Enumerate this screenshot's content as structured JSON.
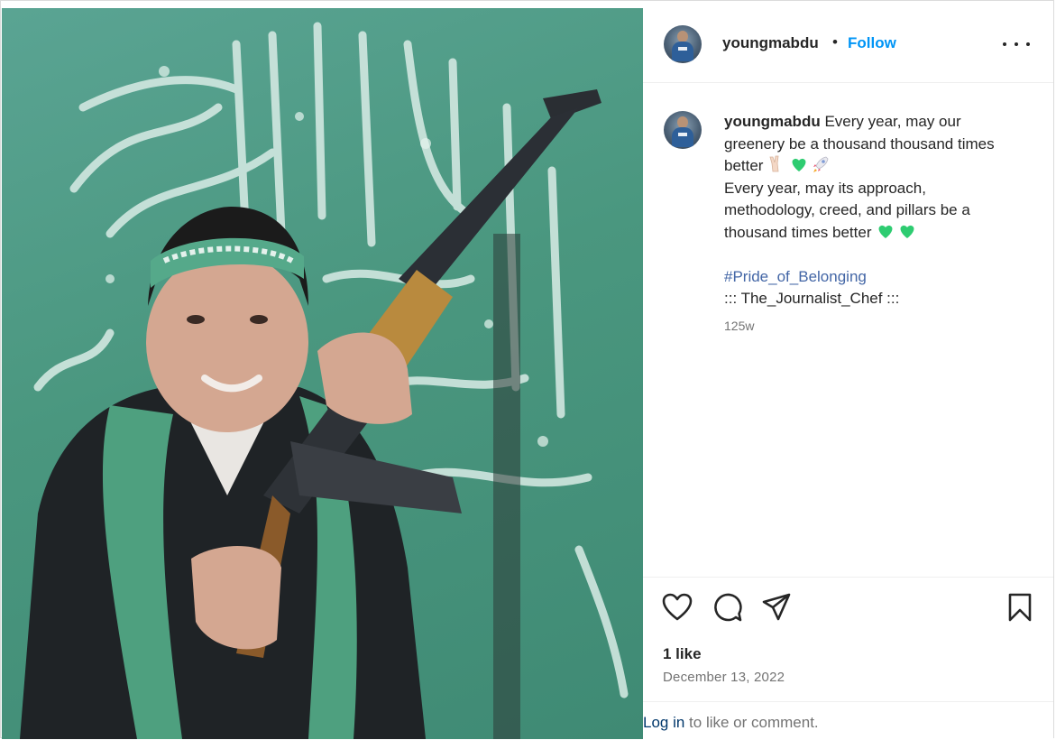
{
  "post": {
    "username": "youngmabdu",
    "follow_label": "Follow",
    "separator": "•",
    "more_icon": "more-horizontal-icon"
  },
  "caption": {
    "username": "youngmabdu",
    "line1": "Every year, may our",
    "line2": "greenery be a thousand thousand times",
    "line3": "better",
    "line3_emojis": [
      "victory-hand",
      "green-heart",
      "rocket"
    ],
    "line4": "Every year, may its approach,",
    "line5": "methodology, creed, and pillars be a",
    "line6": "thousand times better",
    "line6_emojis": [
      "green-heart",
      "green-heart"
    ],
    "hashtag": "#Pride_of_Belonging",
    "signature": "::: The_Journalist_Chef :::",
    "time_ago": "125w"
  },
  "actions": {
    "like_icon": "heart-icon",
    "comment_icon": "comment-icon",
    "share_icon": "share-icon",
    "save_icon": "bookmark-icon"
  },
  "stats": {
    "likes": "1 like",
    "date": "December 13, 2022"
  },
  "footer": {
    "login_label": "Log in",
    "rest": " to like or comment."
  },
  "colors": {
    "accent": "#0095f6",
    "hashtag": "#4366a6",
    "emoji_green": "#2ecc71",
    "flag_green": "#4a977f"
  }
}
